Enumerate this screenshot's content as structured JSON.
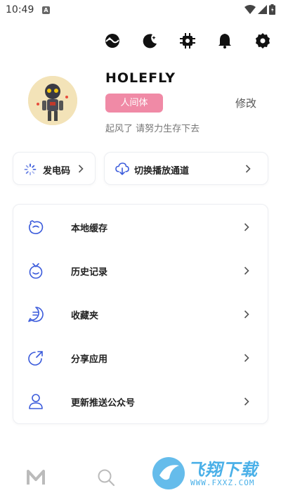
{
  "status_bar": {
    "time": "10:49",
    "notification_icon": "A"
  },
  "top_bar": {
    "icons": [
      "theme-icon",
      "night-mode-icon",
      "settings-chip-icon",
      "bell-icon",
      "settings-gear-icon"
    ]
  },
  "profile": {
    "username": "HOLEFLY",
    "badge": "人间体",
    "edit_label": "修改",
    "signature": "起风了 请努力生存下去",
    "badge_color": "#f08aa6"
  },
  "quick_actions": [
    {
      "label": "发电码",
      "icon": "loading-spinner-icon"
    },
    {
      "label": "切换播放通道",
      "icon": "cloud-download-icon"
    }
  ],
  "menu": {
    "items": [
      {
        "label": "本地缓存",
        "icon": "storage-icon"
      },
      {
        "label": "历史记录",
        "icon": "tv-history-icon"
      },
      {
        "label": "收藏夹",
        "icon": "favorites-icon"
      },
      {
        "label": "分享应用",
        "icon": "share-icon"
      },
      {
        "label": "更新推送公众号",
        "icon": "user-icon"
      }
    ]
  },
  "bottom_nav": {
    "items": [
      "home-m-icon",
      "search-icon"
    ]
  },
  "watermark": {
    "text": "飞翔下载",
    "url": "WWW.FXXZ.COM"
  },
  "colors": {
    "accent_blue": "#3b5bdb",
    "watermark": "#4ab0e8"
  }
}
